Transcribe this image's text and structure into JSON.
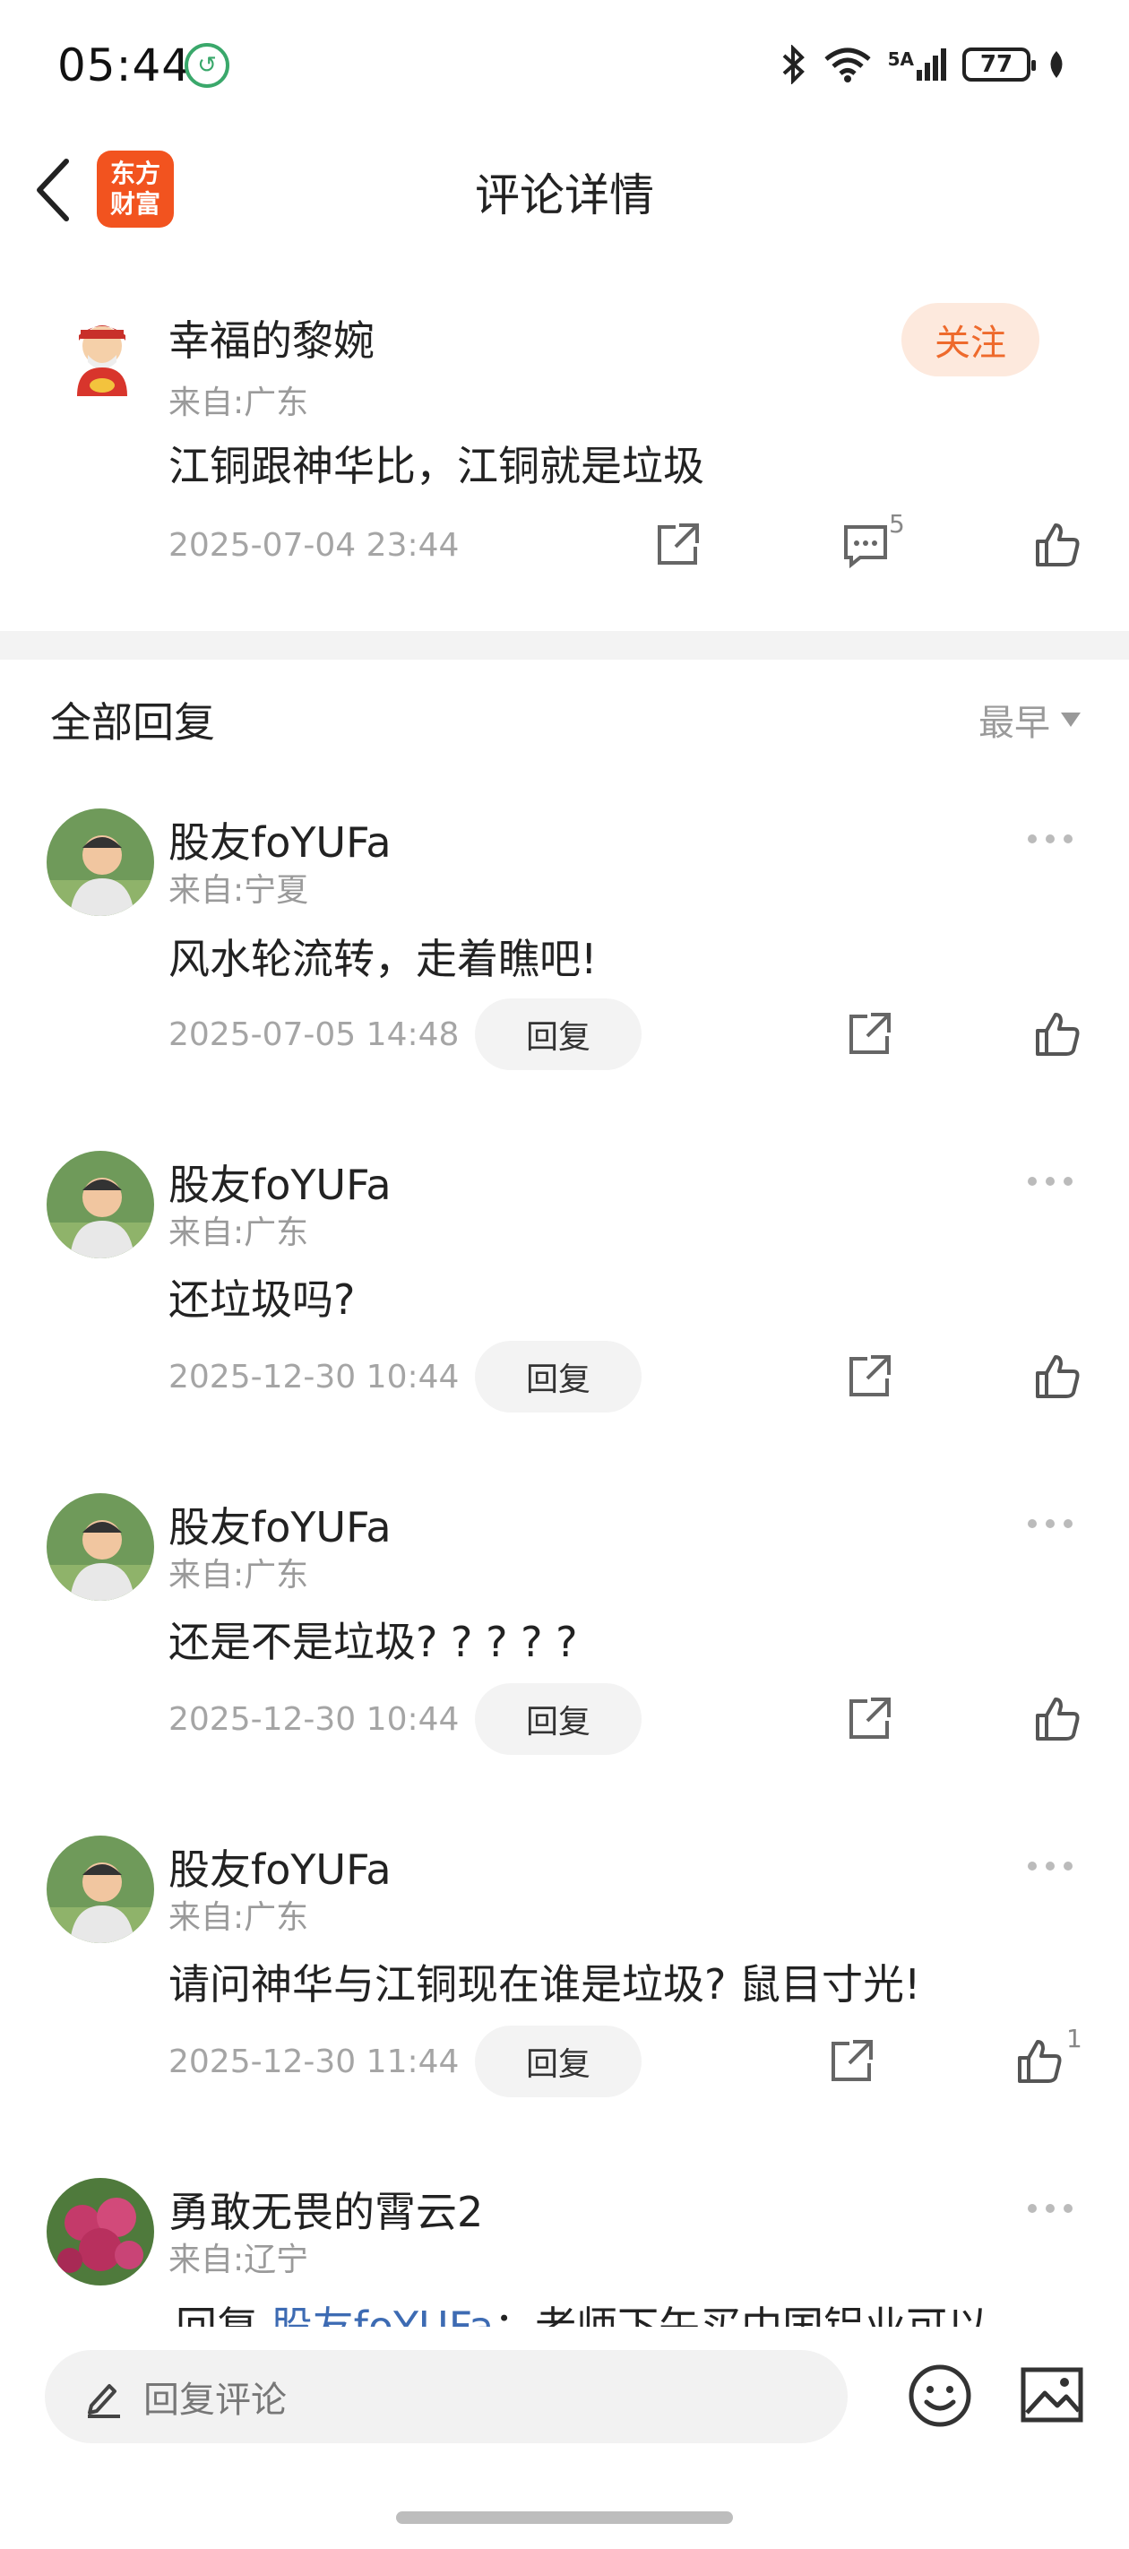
{
  "status_bar": {
    "time": "05:44",
    "network": "5A",
    "battery": "77"
  },
  "header": {
    "title": "评论详情",
    "logo_text_line1": "东方",
    "logo_text_line2": "财富"
  },
  "main_post": {
    "username": "幸福的黎婉",
    "location": "来自:广东",
    "content": "江铜跟神华比，江铜就是垃圾",
    "timestamp": "2025-07-04 23:44",
    "comment_count": "5",
    "follow_label": "关注"
  },
  "replies_section": {
    "title": "全部回复",
    "sort_label": "最早",
    "reply_button_label": "回复"
  },
  "replies": [
    {
      "username": "股友foYUFa",
      "location": "来自:宁夏",
      "content": "风水轮流转，走着瞧吧!",
      "timestamp": "2025-07-05 14:48",
      "likes": ""
    },
    {
      "username": "股友foYUFa",
      "location": "来自:广东",
      "content": "还垃圾吗?",
      "timestamp": "2025-12-30 10:44",
      "likes": ""
    },
    {
      "username": "股友foYUFa",
      "location": "来自:广东",
      "content": "还是不是垃圾? ? ? ? ?",
      "timestamp": "2025-12-30 10:44",
      "likes": ""
    },
    {
      "username": "股友foYUFa",
      "location": "来自:广东",
      "content": "请问神华与江铜现在谁是垃圾? 鼠目寸光!",
      "timestamp": "2025-12-30 11:44",
      "likes": "1"
    },
    {
      "username": "勇敢无畏的霄云2",
      "location": "来自:辽宁",
      "content_prefix": "回复",
      "mention": "股友foYUFa",
      "content": "：老师下午买中国铝业可以"
    }
  ],
  "bottom_bar": {
    "input_placeholder": "回复评论"
  }
}
